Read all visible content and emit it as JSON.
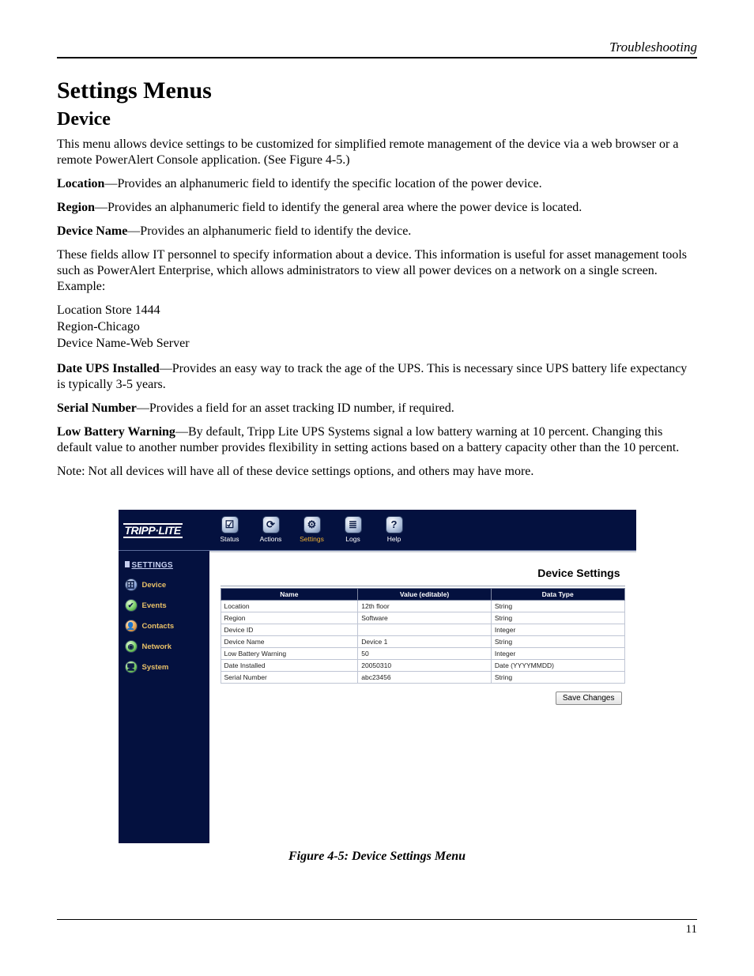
{
  "page": {
    "running_head": "Troubleshooting",
    "title": "Settings Menus",
    "subtitle": "Device",
    "number": "11"
  },
  "paragraphs": {
    "intro": "This menu allows device settings to be customized for simplified remote management of the device via a web browser or a remote PowerAlert Console application. (See Figure 4-5.)",
    "location_lbl": "Location",
    "location_txt": "—Provides an alphanumeric field to identify the specific location of the power device.",
    "region_lbl": "Region",
    "region_txt": "—Provides an alphanumeric field to identify the general area where the power device is located.",
    "devicename_lbl": "Device Name",
    "devicename_txt": "—Provides an alphanumeric field to identify the device.",
    "fields_txt": "These fields allow IT personnel to specify information about a device. This information is useful for asset management tools such as PowerAlert Enterprise, which allows administrators to view all power devices on a network on a single screen. Example:",
    "example_l1": "Location Store 1444",
    "example_l2": "Region-Chicago",
    "example_l3": "Device Name-Web Server",
    "dateups_lbl": "Date UPS Installed",
    "dateups_txt": "—Provides an easy way to track the age of the UPS. This is necessary since UPS battery life expectancy is typically 3-5 years.",
    "serial_lbl": "Serial Number",
    "serial_txt": "—Provides a field for an asset tracking ID number, if required.",
    "lowbatt_lbl": "Low Battery Warning",
    "lowbatt_txt": "—By default, Tripp Lite UPS Systems signal a low battery warning at 10 percent. Changing this default value to another number provides  flexibility in setting actions based on a battery capacity other than the 10 percent.",
    "note": "Note: Not all devices will have all of these device settings options, and others may have more."
  },
  "app": {
    "brand": "TRIPP·LITE",
    "toolbar": [
      {
        "label": "Status",
        "icon": "status-icon",
        "glyph": "☑"
      },
      {
        "label": "Actions",
        "icon": "actions-icon",
        "glyph": "⟳"
      },
      {
        "label": "Settings",
        "icon": "settings-icon",
        "glyph": "⚙"
      },
      {
        "label": "Logs",
        "icon": "logs-icon",
        "glyph": "≣"
      },
      {
        "label": "Help",
        "icon": "help-icon",
        "glyph": "?"
      }
    ],
    "active_tab": "Settings",
    "sidebar_title": "SETTINGS",
    "sidebar": [
      {
        "label": "Device",
        "icon": "device-icon",
        "glyph": "🗄",
        "cls": ""
      },
      {
        "label": "Events",
        "icon": "events-icon",
        "glyph": "✔",
        "cls": "green"
      },
      {
        "label": "Contacts",
        "icon": "contacts-icon",
        "glyph": "👤",
        "cls": "orange"
      },
      {
        "label": "Network",
        "icon": "network-icon",
        "glyph": "◉",
        "cls": "green"
      },
      {
        "label": "System",
        "icon": "system-icon",
        "glyph": "🖥",
        "cls": "green"
      }
    ],
    "content_title": "Device Settings",
    "columns": {
      "name": "Name",
      "value": "Value (editable)",
      "type": "Data Type"
    },
    "rows": [
      {
        "name": "Location",
        "value": "12th floor",
        "type": "String"
      },
      {
        "name": "Region",
        "value": "Software",
        "type": "String"
      },
      {
        "name": "Device ID",
        "value": "",
        "type": "Integer"
      },
      {
        "name": "Device Name",
        "value": "Device 1",
        "type": "String"
      },
      {
        "name": "Low Battery Warning",
        "value": "50",
        "type": "Integer"
      },
      {
        "name": "Date Installed",
        "value": "20050310",
        "type": "Date (YYYYMMDD)"
      },
      {
        "name": "Serial Number",
        "value": "abc23456",
        "type": "String"
      }
    ],
    "save_label": "Save Changes"
  },
  "figure_caption": "Figure 4-5: Device Settings Menu"
}
